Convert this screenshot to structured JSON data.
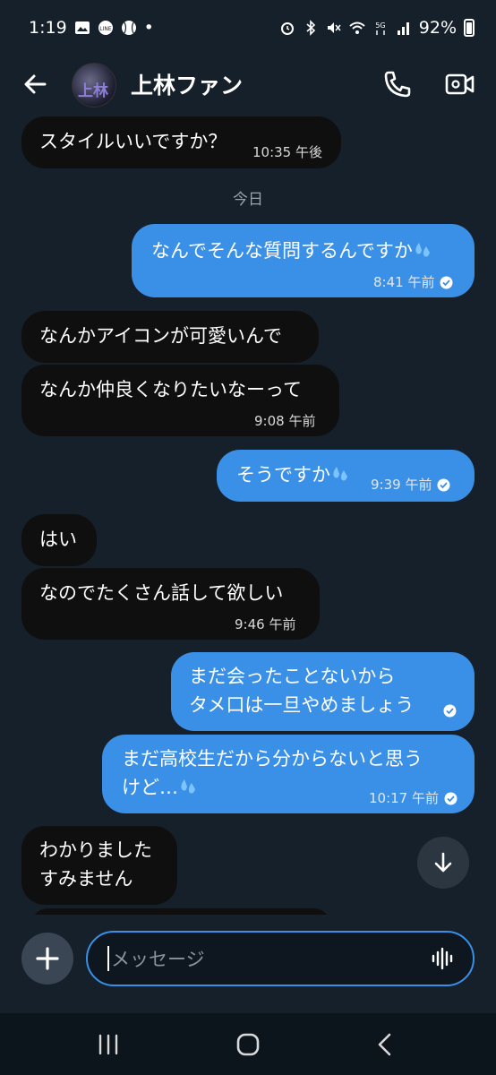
{
  "status_bar": {
    "time": "1:19",
    "battery": "92%",
    "dot": "•",
    "left_icons": [
      "gallery-icon",
      "line-icon",
      "baseball-icon"
    ],
    "right_icons": [
      "alarm-icon",
      "bluetooth-icon",
      "mute-icon",
      "wifi-icon",
      "5g-icon",
      "signal-icon",
      "battery-icon"
    ]
  },
  "header": {
    "contact_name": "上林ファン",
    "avatar_text": "上林"
  },
  "chat": {
    "date_separator": "今日",
    "messages": [
      {
        "dir": "in",
        "text": "スタイルいいですか？",
        "time": "10:35 午後"
      },
      {
        "dir": "out",
        "text": "なんでそんな質問するんですか",
        "time": "8:41 午前",
        "emoji": "sweat-droplets"
      },
      {
        "dir": "in",
        "text": "なんかアイコンが可愛いんで"
      },
      {
        "dir": "in",
        "text": "なんか仲良くなりたいなーって",
        "time": "9:08 午前"
      },
      {
        "dir": "out",
        "text": "そうですか",
        "time": "9:39 午前",
        "emoji": "sweat-droplets"
      },
      {
        "dir": "in",
        "text": "はい"
      },
      {
        "dir": "in",
        "text": "なのでたくさん話して欲しい",
        "time": "9:46 午前"
      },
      {
        "dir": "out",
        "lines": [
          "まだ会ったことないから",
          "タメ口は一旦やめましょう"
        ]
      },
      {
        "dir": "out",
        "lines": [
          "まだ高校生だから分からないと思う",
          "けど…"
        ],
        "time": "10:17 午前",
        "emoji": "sweat-droplets"
      },
      {
        "dir": "in",
        "lines": [
          "わかりました",
          "すみません"
        ]
      }
    ]
  },
  "composer": {
    "placeholder": "メッセージ"
  },
  "colors": {
    "background": "#15202b",
    "incoming_bubble": "#0f0f10",
    "outgoing_bubble": "#3a90e6",
    "input_border": "#3a90e6"
  }
}
